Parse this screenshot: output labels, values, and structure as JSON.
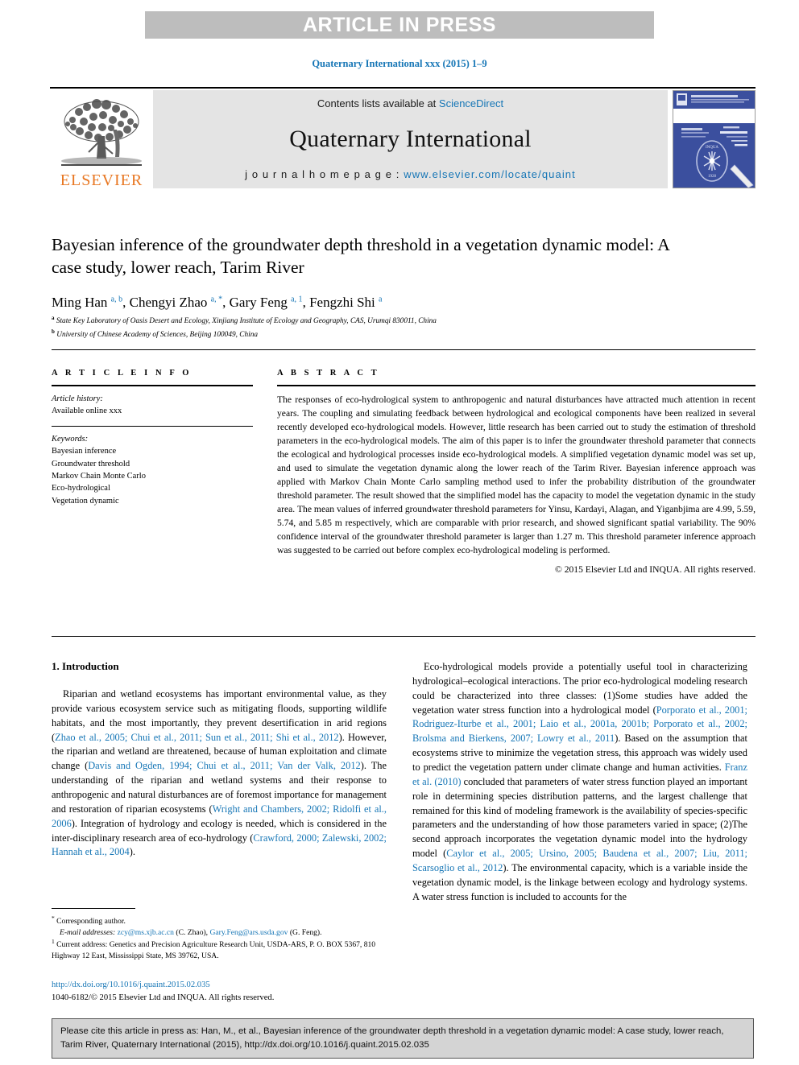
{
  "banner": {
    "text": "ARTICLE IN PRESS"
  },
  "journal_ref": "Quaternary International xxx (2015) 1–9",
  "masthead": {
    "publisher_name": "ELSEVIER",
    "contents_prefix": "Contents lists available at ",
    "contents_link": "ScienceDirect",
    "journal_name": "Quaternary International",
    "homepage_prefix": "j o u r n a l   h o m e p a g e :  ",
    "homepage_url": "www.elsevier.com/locate/quaint",
    "cover_alt": "Quaternary International journal cover"
  },
  "article": {
    "title": "Bayesian inference of the groundwater depth threshold in a vegetation dynamic model: A case study, lower reach, Tarim River",
    "authors_html": "Ming Han <sup>a, b</sup>, Chengyi Zhao <sup>a, *</sup>, Gary Feng <sup>a, 1</sup>, Fengzhi Shi <sup>a</sup>",
    "affiliation_a": "State Key Laboratory of Oasis Desert and Ecology, Xinjiang Institute of Ecology and Geography, CAS, Urumqi 830011, China",
    "affiliation_b": "University of Chinese Academy of Sciences, Beijing 100049, China"
  },
  "article_info": {
    "heading": "A R T I C L E   I N F O",
    "history_label": "Article history:",
    "history_value": "Available online xxx",
    "keywords_label": "Keywords:",
    "keywords": [
      "Bayesian inference",
      "Groundwater threshold",
      "Markov Chain Monte Carlo",
      "Eco-hydrological",
      "Vegetation dynamic"
    ]
  },
  "abstract": {
    "heading": "A B S T R A C T",
    "text": "The responses of eco-hydrological system to anthropogenic and natural disturbances have attracted much attention in recent years. The coupling and simulating feedback between hydrological and ecological components have been realized in several recently developed eco-hydrological models. However, little research has been carried out to study the estimation of threshold parameters in the eco-hydrological models. The aim of this paper is to infer the groundwater threshold parameter that connects the ecological and hydrological processes inside eco-hydrological models. A simplified vegetation dynamic model was set up, and used to simulate the vegetation dynamic along the lower reach of the Tarim River. Bayesian inference approach was applied with Markov Chain Monte Carlo sampling method used to infer the probability distribution of the groundwater threshold parameter. The result showed that the simplified model has the capacity to model the vegetation dynamic in the study area. The mean values of inferred groundwater threshold parameters for Yinsu, Kardayi, Alagan, and Yiganbjima are 4.99, 5.59, 5.74, and 5.85 m respectively, which are comparable with prior research, and showed significant spatial variability. The 90% confidence interval of the groundwater threshold parameter is larger than 1.27 m. This threshold parameter inference approach was suggested to be carried out before complex eco-hydrological modeling is performed.",
    "copyright": "© 2015 Elsevier Ltd and INQUA. All rights reserved."
  },
  "intro": {
    "heading": "1. Introduction",
    "left_paragraph_html": "Riparian and wetland ecosystems has important environmental value, as they provide various ecosystem service such as mitigating floods, supporting wildlife habitats, and the most importantly, they prevent desertification in arid regions (<span class=\"ref\">Zhao et al., 2005; Chui et al., 2011; Sun et al., 2011; Shi et al., 2012</span>). However, the riparian and wetland are threatened, because of human exploitation and climate change (<span class=\"ref\">Davis and Ogden, 1994; Chui et al., 2011; Van der Valk, 2012</span>). The understanding of the riparian and wetland systems and their response to anthropogenic and natural disturbances are of foremost importance for management and restoration of riparian ecosystems (<span class=\"ref\">Wright and Chambers, 2002; Ridolfi et al., 2006</span>). Integration of hydrology and ecology is needed, which is considered in the inter-disciplinary research area of eco-hydrology (<span class=\"ref\">Crawford, 2000; Zalewski, 2002; Hannah et al., 2004</span>).",
    "right_paragraph_html": "Eco-hydrological models provide a potentially useful tool in characterizing hydrological–ecological interactions. The prior eco-hydrological modeling research could be characterized into three classes: (1)Some studies have added the vegetation water stress function into a hydrological model (<span class=\"ref\">Porporato et al., 2001; Rodriguez-Iturbe et al., 2001; Laio et al., 2001a, 2001b; Porporato et al., 2002; Brolsma and Bierkens, 2007; Lowry et al., 2011</span>). Based on the assumption that ecosystems strive to minimize the vegetation stress, this approach was widely used to predict the vegetation pattern under climate change and human activities. <span class=\"ref\">Franz et al. (2010)</span> concluded that parameters of water stress function played an important role in determining species distribution patterns, and the largest challenge that remained for this kind of modeling framework is the availability of species-specific parameters and the understanding of how those parameters varied in space; (2)The second approach incorporates the vegetation dynamic model into the hydrology model (<span class=\"ref\">Caylor et al., 2005; Ursino, 2005; Baudena et al., 2007; Liu, 2011; Scarsoglio et al., 2012</span>). The environmental capacity, which is a variable inside the vegetation dynamic model, is the linkage between ecology and hydrology systems. A water stress function is included to accounts for the"
  },
  "footnotes": {
    "corresponding_html": "<sup>*</sup> Corresponding author.",
    "emails_html": "<span class=\"ital\">E-mail addresses:</span> <span class=\"lnk\">zcy@ms.xjb.ac.cn</span> (C. Zhao), <span class=\"lnk\">Gary.Feng@ars.usda.gov</span> (G. Feng).",
    "current_address_html": "<sup>1</sup> Current address: Genetics and Precision Agriculture Research Unit, USDA-ARS, P. O. BOX 5367, 810 Highway 12 East, Mississippi State, MS 39762, USA."
  },
  "doi_block": {
    "doi_url": "http://dx.doi.org/10.1016/j.quaint.2015.02.035",
    "issn_line": "1040-6182/© 2015 Elsevier Ltd and INQUA. All rights reserved."
  },
  "cite_footer": {
    "text": "Please cite this article in press as: Han, M., et al., Bayesian inference of the groundwater depth threshold in a vegetation dynamic model: A case study, lower reach, Tarim River, Quaternary International (2015), http://dx.doi.org/10.1016/j.quaint.2015.02.035"
  },
  "colors": {
    "link_blue": "#1676b6",
    "elsevier_orange": "#e87722",
    "banner_gray": "#bdbdbd",
    "masthead_gray": "#e4e4e4",
    "cite_box_gray": "#d4d4d4",
    "cover_blue": "#3b4f9e"
  }
}
